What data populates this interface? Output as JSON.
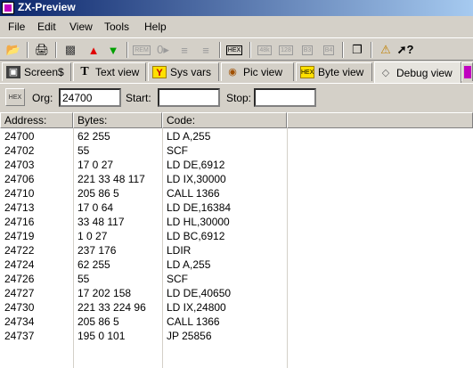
{
  "window": {
    "title": "ZX-Preview"
  },
  "menu": [
    "File",
    "Edit",
    "View",
    "Tools",
    "Help"
  ],
  "toolbar": {
    "rem_label": "REM",
    "hex_label": "HEX",
    "r48k_label": "48k",
    "r128_label": "128",
    "b3_label": "B3",
    "b4_label": "B4"
  },
  "tabs": [
    "Screen$",
    "Text view",
    "Sys vars",
    "Pic view",
    "Byte view",
    "Debug view"
  ],
  "active_tab": "Debug view",
  "org_bar": {
    "hex_label": "HEX",
    "org_label": "Org:",
    "org_value": "24700",
    "start_label": "Start:",
    "start_value": "",
    "stop_label": "Stop:",
    "stop_value": ""
  },
  "table": {
    "columns": [
      "Address:",
      "Bytes:",
      "Code:"
    ],
    "rows": [
      [
        "24700",
        "62 255",
        "LD A,255"
      ],
      [
        "24702",
        "55",
        "SCF"
      ],
      [
        "24703",
        "17 0 27",
        "LD DE,6912"
      ],
      [
        "24706",
        "221 33 48 117",
        "LD IX,30000"
      ],
      [
        "24710",
        "205 86 5",
        "CALL 1366"
      ],
      [
        "24713",
        "17 0 64",
        "LD DE,16384"
      ],
      [
        "24716",
        "33 48 117",
        "LD HL,30000"
      ],
      [
        "24719",
        "1 0 27",
        "LD BC,6912"
      ],
      [
        "24722",
        "237 176",
        "LDIR"
      ],
      [
        "24724",
        "62 255",
        "LD A,255"
      ],
      [
        "24726",
        "55",
        "SCF"
      ],
      [
        "24727",
        "17 202 158",
        "LD DE,40650"
      ],
      [
        "24730",
        "221 33 224 96",
        "LD IX,24800"
      ],
      [
        "24734",
        "205 86 5",
        "CALL 1366"
      ],
      [
        "24737",
        "195 0 101",
        "JP 25856"
      ]
    ]
  },
  "colors": {
    "title_start": "#0a246a",
    "title_end": "#a6caf0",
    "face": "#d4d0c8"
  }
}
